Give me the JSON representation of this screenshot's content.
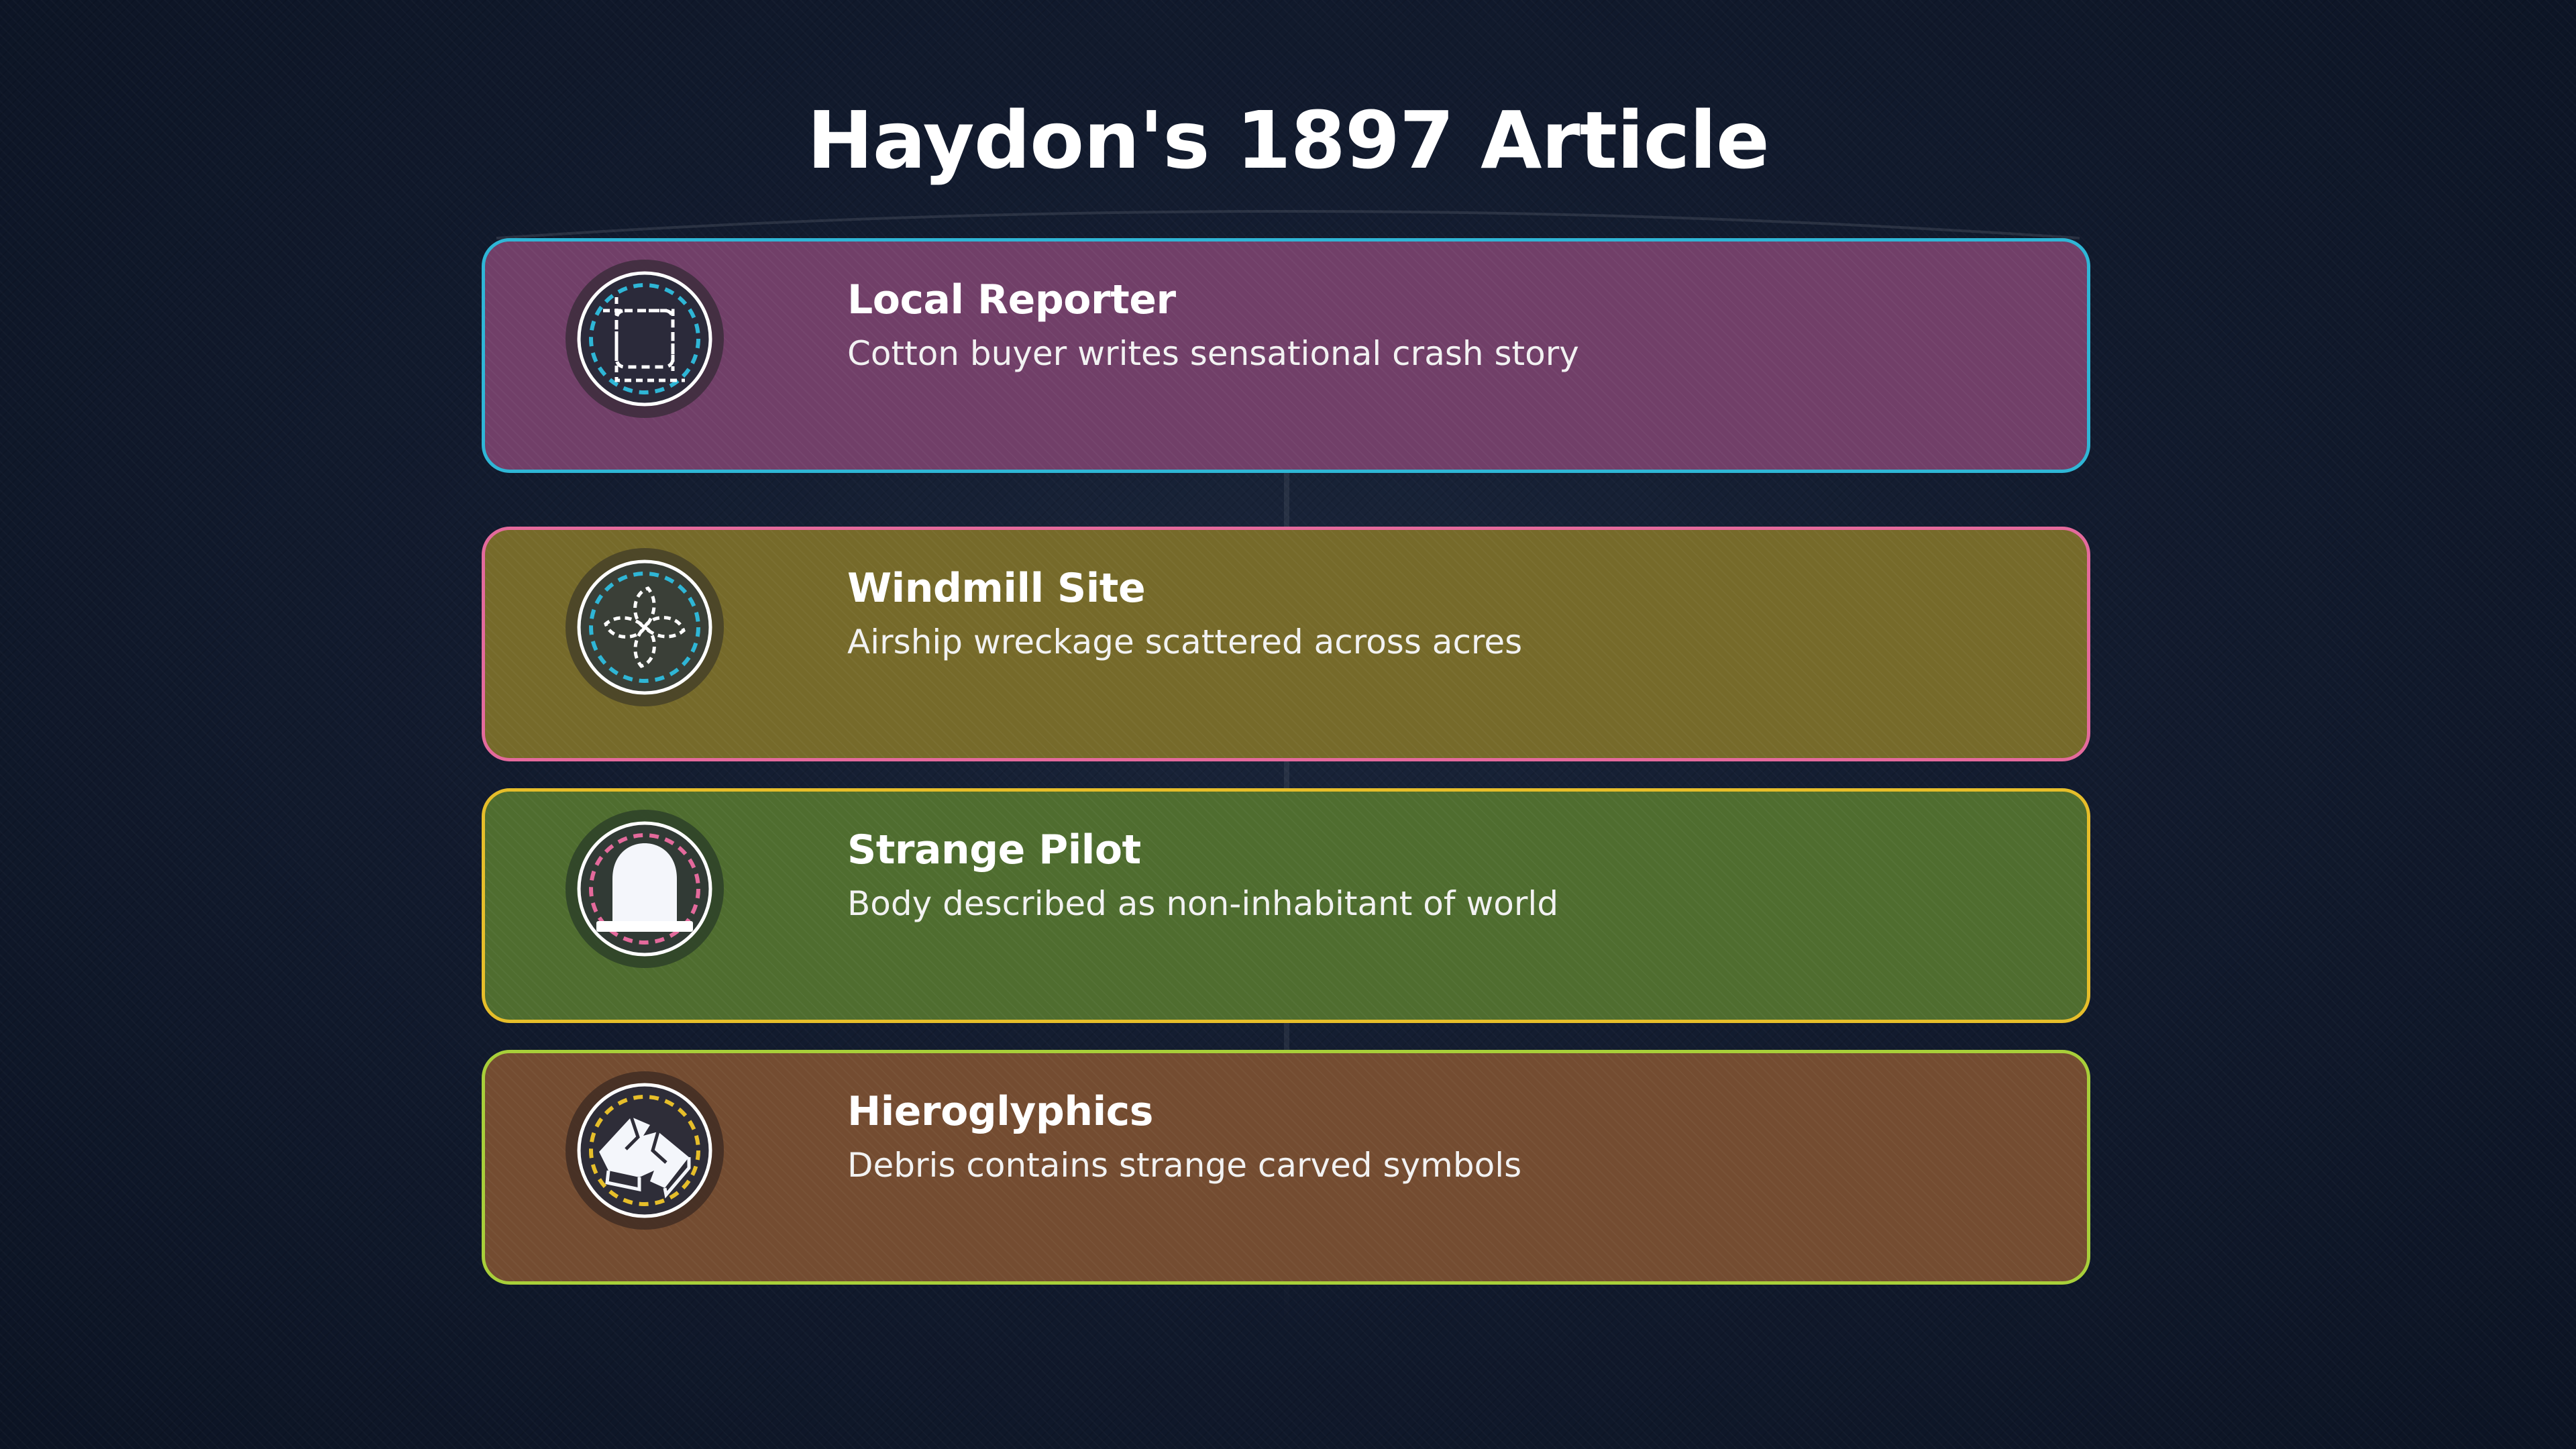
{
  "title": "Haydon's 1897 Article",
  "cards": [
    {
      "heading": "Local Reporter",
      "description": "Cotton buyer writes sensational crash story",
      "icon": "frame-crop-icon",
      "background": "#713f68",
      "border": "#2fb6d6"
    },
    {
      "heading": "Windmill Site",
      "description": "Airship wreckage scattered across acres",
      "icon": "windmill-fan-icon",
      "background": "#766a2a",
      "border": "#e46a9c"
    },
    {
      "heading": "Strange Pilot",
      "description": "Body described as non-inhabitant of world",
      "icon": "headstone-icon",
      "background": "#4f6d2f",
      "border": "#e6be2a"
    },
    {
      "heading": "Hieroglyphics",
      "description": "Debris contains strange carved symbols",
      "icon": "broken-tablet-icon",
      "background": "#744c31",
      "border": "#a8cf3a"
    }
  ]
}
